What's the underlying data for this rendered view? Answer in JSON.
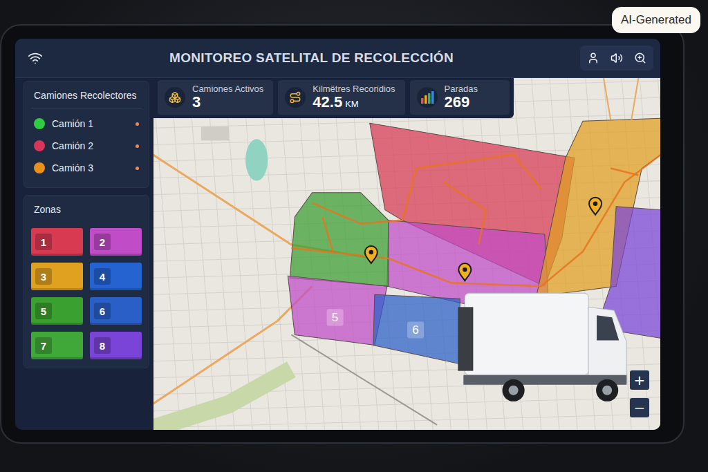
{
  "badge": "AI-Generated",
  "header": {
    "title": "MONITOREO SATELITAL DE RECOLECCIÓN"
  },
  "trucks": {
    "title": "Camiones Recolectores",
    "items": [
      {
        "name": "Camión 1",
        "color": "#2ecc40"
      },
      {
        "name": "Camión 2",
        "color": "#d9345a"
      },
      {
        "name": "Camión 3",
        "color": "#e8901a"
      }
    ]
  },
  "zones": {
    "title": "Zonas",
    "items": [
      {
        "label": "1",
        "color": "#d83a52"
      },
      {
        "label": "2",
        "color": "#c04cc8"
      },
      {
        "label": "3",
        "color": "#e0a020"
      },
      {
        "label": "4",
        "color": "#2563d0"
      },
      {
        "label": "5",
        "color": "#3aa030"
      },
      {
        "label": "6",
        "color": "#2a5fc8"
      },
      {
        "label": "7",
        "color": "#40a838"
      },
      {
        "label": "8",
        "color": "#7a44d8"
      }
    ]
  },
  "stats": [
    {
      "label": "Camiones Activos",
      "value": "3"
    },
    {
      "label": "Kilmëtres Recoridios",
      "value": "42.5",
      "unit": "KM"
    },
    {
      "label": "Paradas",
      "value": "269"
    }
  ],
  "map": {
    "labels": [
      {
        "text": "5"
      },
      {
        "text": "6"
      }
    ],
    "zoom": [
      "+",
      "−"
    ]
  }
}
